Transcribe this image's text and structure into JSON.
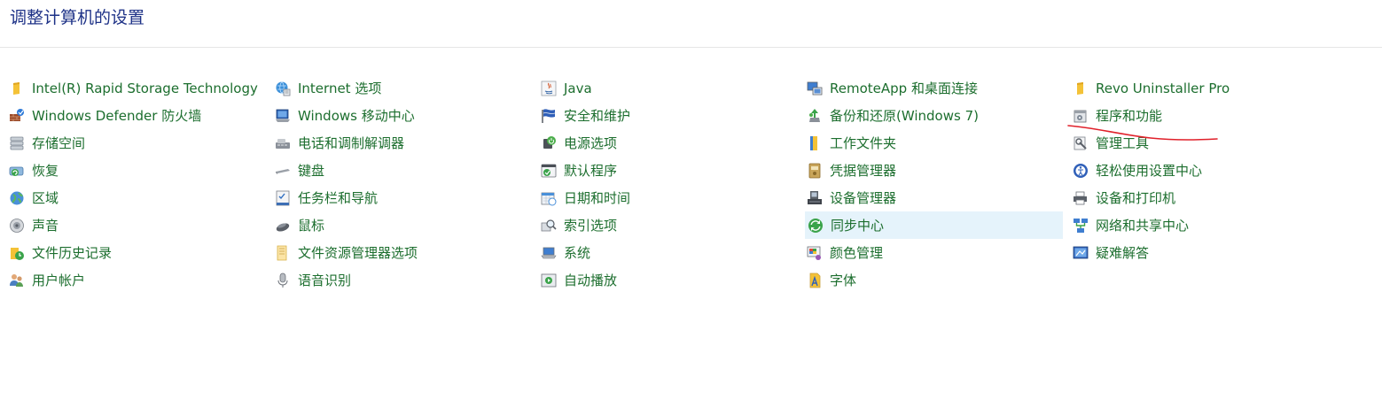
{
  "page": {
    "title": "调整计算机的设置"
  },
  "columns": [
    {
      "items": [
        {
          "label": "Intel(R) Rapid Storage Technology",
          "icon": "folder-icon"
        },
        {
          "label": "Windows Defender 防火墙",
          "icon": "firewall-icon"
        },
        {
          "label": "存储空间",
          "icon": "storage-spaces-icon"
        },
        {
          "label": "恢复",
          "icon": "recovery-icon"
        },
        {
          "label": "区域",
          "icon": "region-globe-icon"
        },
        {
          "label": "声音",
          "icon": "speaker-icon"
        },
        {
          "label": "文件历史记录",
          "icon": "file-history-icon"
        },
        {
          "label": "用户帐户",
          "icon": "user-accounts-icon"
        }
      ]
    },
    {
      "items": [
        {
          "label": "Internet 选项",
          "icon": "internet-options-icon"
        },
        {
          "label": "Windows 移动中心",
          "icon": "mobility-center-icon"
        },
        {
          "label": "电话和调制解调器",
          "icon": "phone-modem-icon"
        },
        {
          "label": "键盘",
          "icon": "keyboard-icon"
        },
        {
          "label": "任务栏和导航",
          "icon": "taskbar-icon"
        },
        {
          "label": "鼠标",
          "icon": "mouse-icon"
        },
        {
          "label": "文件资源管理器选项",
          "icon": "folder-options-icon"
        },
        {
          "label": "语音识别",
          "icon": "microphone-icon"
        }
      ]
    },
    {
      "items": [
        {
          "label": "Java",
          "icon": "java-icon"
        },
        {
          "label": "安全和维护",
          "icon": "security-flag-icon"
        },
        {
          "label": "电源选项",
          "icon": "power-options-icon"
        },
        {
          "label": "默认程序",
          "icon": "default-programs-icon"
        },
        {
          "label": "日期和时间",
          "icon": "calendar-clock-icon"
        },
        {
          "label": "索引选项",
          "icon": "indexing-icon"
        },
        {
          "label": "系统",
          "icon": "system-laptop-icon"
        },
        {
          "label": "自动播放",
          "icon": "autoplay-icon"
        }
      ]
    },
    {
      "items": [
        {
          "label": "RemoteApp 和桌面连接",
          "icon": "remoteapp-icon"
        },
        {
          "label": "备份和还原(Windows 7)",
          "icon": "backup-restore-icon"
        },
        {
          "label": "工作文件夹",
          "icon": "work-folders-icon"
        },
        {
          "label": "凭据管理器",
          "icon": "credential-manager-icon"
        },
        {
          "label": "设备管理器",
          "icon": "device-manager-icon"
        },
        {
          "label": "同步中心",
          "icon": "sync-center-icon",
          "hovered": true
        },
        {
          "label": "颜色管理",
          "icon": "color-management-icon"
        },
        {
          "label": "字体",
          "icon": "fonts-icon"
        }
      ]
    },
    {
      "items": [
        {
          "label": "Revo Uninstaller Pro",
          "icon": "folder-icon"
        },
        {
          "label": "程序和功能",
          "icon": "programs-features-icon"
        },
        {
          "label": "管理工具",
          "icon": "admin-tools-icon"
        },
        {
          "label": "轻松使用设置中心",
          "icon": "ease-of-access-icon"
        },
        {
          "label": "设备和打印机",
          "icon": "printer-icon"
        },
        {
          "label": "网络和共享中心",
          "icon": "network-icon"
        },
        {
          "label": "疑难解答",
          "icon": "troubleshooting-icon"
        }
      ]
    }
  ],
  "colors": {
    "title": "#1e3287",
    "link": "#1c6e2e",
    "hover_bg": "#e5f3fb",
    "annotation": "#e0202a"
  }
}
